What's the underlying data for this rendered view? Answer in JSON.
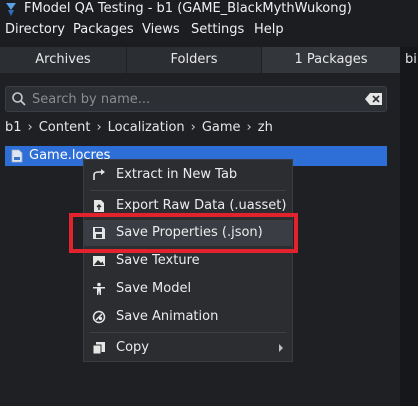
{
  "window": {
    "title": "FModel QA Testing - b1 (GAME_BlackMythWukong)"
  },
  "menu": [
    "Directory",
    "Packages",
    "Views",
    "Settings",
    "Help"
  ],
  "tabs": [
    {
      "label": "Archives"
    },
    {
      "label": "Folders"
    },
    {
      "label": "1 Packages",
      "active": true
    }
  ],
  "right_tab_stub": "bi",
  "search": {
    "placeholder": "Search by name...",
    "value": ""
  },
  "breadcrumb": [
    "b1",
    "Content",
    "Localization",
    "Game",
    "zh"
  ],
  "file": {
    "name": "Game.locres",
    "selected": true
  },
  "context_menu": {
    "items": [
      {
        "label": "Extract in New Tab",
        "icon": "extract-icon"
      },
      {
        "label": "Export Raw Data (.uasset)",
        "icon": "export-file-icon"
      },
      {
        "label": "Save Properties (.json)",
        "icon": "save-disk-icon",
        "highlighted": true
      },
      {
        "label": "Save Texture",
        "icon": "image-icon"
      },
      {
        "label": "Save Model",
        "icon": "person-icon"
      },
      {
        "label": "Save Animation",
        "icon": "animation-icon"
      },
      {
        "label": "Copy",
        "icon": "copy-icon",
        "submenu": true
      }
    ]
  },
  "colors": {
    "background": "#1a1c20",
    "selection": "#2d6fd6",
    "annotation_box": "#e2222c"
  }
}
